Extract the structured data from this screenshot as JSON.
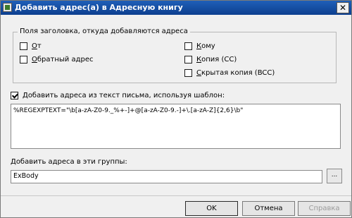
{
  "window": {
    "title": "Добавить адрес(а) в Адресную книгу",
    "close_label": "✕"
  },
  "header_fields": {
    "group_title": "Поля заголовка, откуда добавляются адреса",
    "items": [
      {
        "label": "От",
        "checked": false
      },
      {
        "label": "Обратный адрес",
        "checked": false
      },
      {
        "label": "Кому",
        "checked": false
      },
      {
        "label": "Копия (CC)",
        "checked": false
      },
      {
        "label": "Скрытая копия (BCC)",
        "checked": false
      }
    ]
  },
  "template": {
    "checkbox_label": "Добавить адреса из текст письма, используя шаблон:",
    "checked": true,
    "value": "%REGEXPTEXT=\"\\b[a-zA-Z0-9._%+-]+@[a-zA-Z0-9.-]+\\.[a-zA-Z]{2,6}\\b\""
  },
  "groups": {
    "label": "Добавить адреса в эти группы:",
    "value": "ExBody",
    "browse_label": "..."
  },
  "buttons": {
    "ok": "OK",
    "cancel": "Отмена",
    "help": "Справка"
  }
}
